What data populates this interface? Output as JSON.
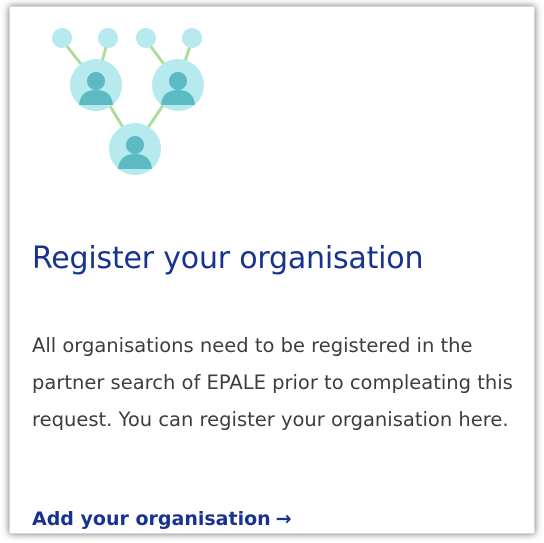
{
  "card": {
    "icon": "organisation-network-icon",
    "title": "Register your organisation",
    "description": "All organisations need to be registered in the partner search of EPALE prior to compleating this request. You can register your organisation here.",
    "link_label": "Add your organisation",
    "link_arrow": "→"
  },
  "colors": {
    "title": "#17338f",
    "link": "#17338f",
    "body_text": "#3d3d3d",
    "icon_outer": "#b5ecef",
    "icon_inner": "#55b8c0",
    "icon_connector": "#9fdc8e"
  }
}
